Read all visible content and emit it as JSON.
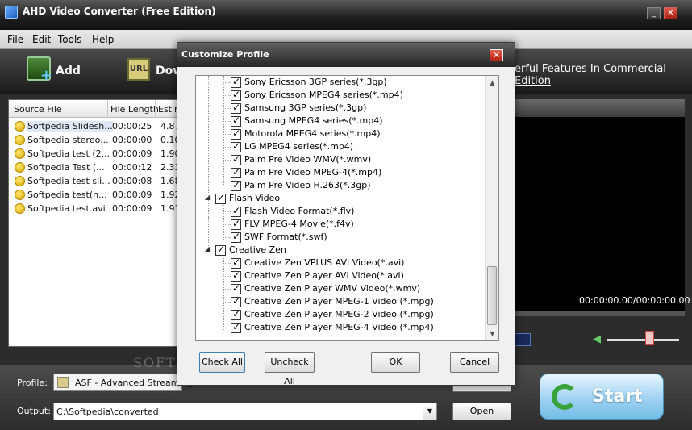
{
  "window": {
    "title": "AHD Video Converter (Free Edition)"
  },
  "menu": [
    "File",
    "Edit",
    "Tools",
    "Help"
  ],
  "toolbar": {
    "add_label": "Add",
    "download_label": "Dow",
    "url_icon_text": "URL",
    "commercial_link": "erful Features In Commercial Edition"
  },
  "filelist": {
    "headers": [
      "Source File",
      "File Length",
      "Estin"
    ],
    "rows": [
      {
        "name": "Softpedia Slidesh...",
        "length": "00:00:25",
        "est": "4.87"
      },
      {
        "name": "Softpedia stereo...",
        "length": "00:00:00",
        "est": "0.10"
      },
      {
        "name": "Softpedia test (2...",
        "length": "00:00:09",
        "est": "1.90"
      },
      {
        "name": "Softpedia Test (...",
        "length": "00:00:12",
        "est": "2.33"
      },
      {
        "name": "Softpedia test sli...",
        "length": "00:00:08",
        "est": "1.68"
      },
      {
        "name": "Softpedia test(n...",
        "length": "00:00:09",
        "est": "1.92"
      },
      {
        "name": "Softpedia test.avi",
        "length": "00:00:09",
        "est": "1.91"
      }
    ]
  },
  "player": {
    "timecode": "00:00:00.00/00:00:00.00"
  },
  "bottom": {
    "profile_label": "Profile:",
    "profile_value": "ASF - Advanced Streaming",
    "output_label": "Output:",
    "output_value": "C:\\Softpedia\\converted",
    "open_button": "Open",
    "start_button": "Start",
    "watermark": "SOFTP"
  },
  "dialog": {
    "title": "Customize Profile",
    "check_all": "Check All",
    "uncheck_all": "Uncheck All",
    "ok": "OK",
    "cancel": "Cancel",
    "tree": {
      "phone_items": [
        "Sony Ericsson 3GP series(*.3gp)",
        "Sony Ericsson MPEG4 series(*.mp4)",
        "Samsung 3GP series(*.3gp)",
        "Samsung MPEG4 series(*.mp4)",
        "Motorola MPEG4 series(*.mp4)",
        "LG MPEG4 series(*.mp4)",
        "Palm Pre Video WMV(*.wmv)",
        "Palm Pre Video MPEG-4(*.mp4)",
        "Palm Pre Video H.263(*.3gp)"
      ],
      "flash_group": "Flash Video",
      "flash_items": [
        "Flash Video Format(*.flv)",
        "FLV MPEG-4 Movie(*.f4v)",
        "SWF Format(*.swf)"
      ],
      "zen_group": "Creative Zen",
      "zen_items": [
        "Creative Zen VPLUS AVI Video(*.avi)",
        "Creative Zen Player AVI Video(*.avi)",
        "Creative Zen Player WMV Video(*.wmv)",
        "Creative Zen Player MPEG-1 Video (*.mpg)",
        "Creative Zen Player MPEG-2 Video (*.mpg)",
        "Creative Zen Player MPEG-4 Video (*.mp4)"
      ]
    }
  }
}
